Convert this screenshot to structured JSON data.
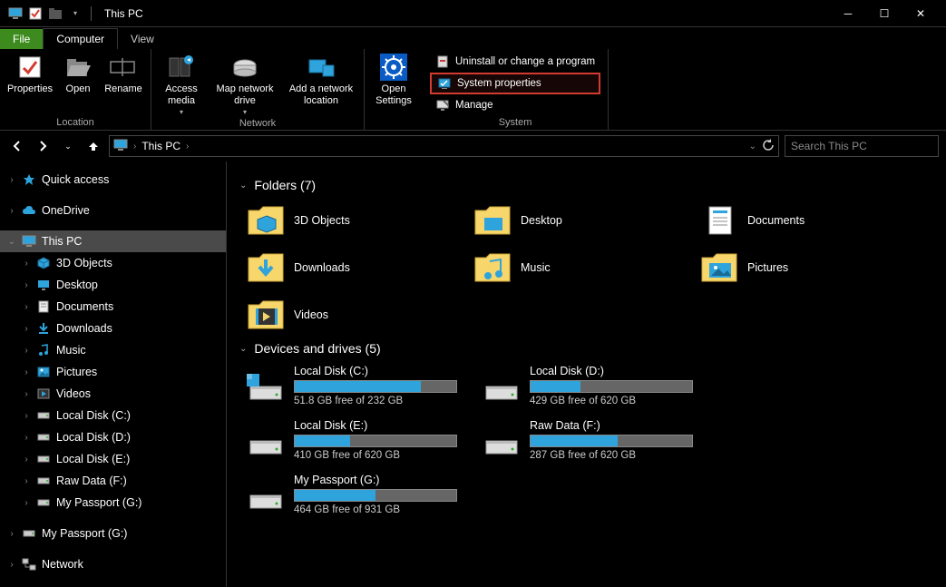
{
  "title_bar": {
    "title": "This PC"
  },
  "tabs": {
    "file": "File",
    "computer": "Computer",
    "view": "View"
  },
  "ribbon": {
    "location": {
      "label": "Location",
      "properties": "Properties",
      "open": "Open",
      "rename": "Rename"
    },
    "network": {
      "label": "Network",
      "access_media": "Access media",
      "map_drive": "Map network drive",
      "add_location": "Add a network location"
    },
    "open_settings": "Open Settings",
    "system": {
      "label": "System",
      "uninstall": "Uninstall or change a program",
      "system_properties": "System properties",
      "manage": "Manage"
    }
  },
  "address": {
    "crumb": "This PC",
    "search_placeholder": "Search This PC"
  },
  "nav": {
    "quick_access": "Quick access",
    "onedrive": "OneDrive",
    "this_pc": "This PC",
    "objects3d": "3D Objects",
    "desktop": "Desktop",
    "documents": "Documents",
    "downloads": "Downloads",
    "music": "Music",
    "pictures": "Pictures",
    "videos": "Videos",
    "local_c": "Local Disk (C:)",
    "local_d": "Local Disk (D:)",
    "local_e": "Local Disk (E:)",
    "raw_f": "Raw Data (F:)",
    "passport_g": "My Passport (G:)",
    "passport_g2": "My Passport (G:)",
    "network": "Network"
  },
  "content": {
    "folders_header": "Folders (7)",
    "drives_header": "Devices and drives (5)",
    "folders": {
      "objects3d": "3D Objects",
      "desktop": "Desktop",
      "documents": "Documents",
      "downloads": "Downloads",
      "music": "Music",
      "pictures": "Pictures",
      "videos": "Videos"
    },
    "drives": [
      {
        "name": "Local Disk (C:)",
        "free_text": "51.8 GB free of 232 GB",
        "fill_pct": 78
      },
      {
        "name": "Local Disk (D:)",
        "free_text": "429 GB free of 620 GB",
        "fill_pct": 31
      },
      {
        "name": "Local Disk (E:)",
        "free_text": "410 GB free of 620 GB",
        "fill_pct": 34
      },
      {
        "name": "Raw Data (F:)",
        "free_text": "287 GB free of 620 GB",
        "fill_pct": 54
      },
      {
        "name": "My Passport (G:)",
        "free_text": "464 GB free of 931 GB",
        "fill_pct": 50
      }
    ]
  },
  "colors": {
    "accent_green": "#3d8b1e",
    "highlight_red": "#d43a2f",
    "progress_blue": "#2ea3dc"
  }
}
